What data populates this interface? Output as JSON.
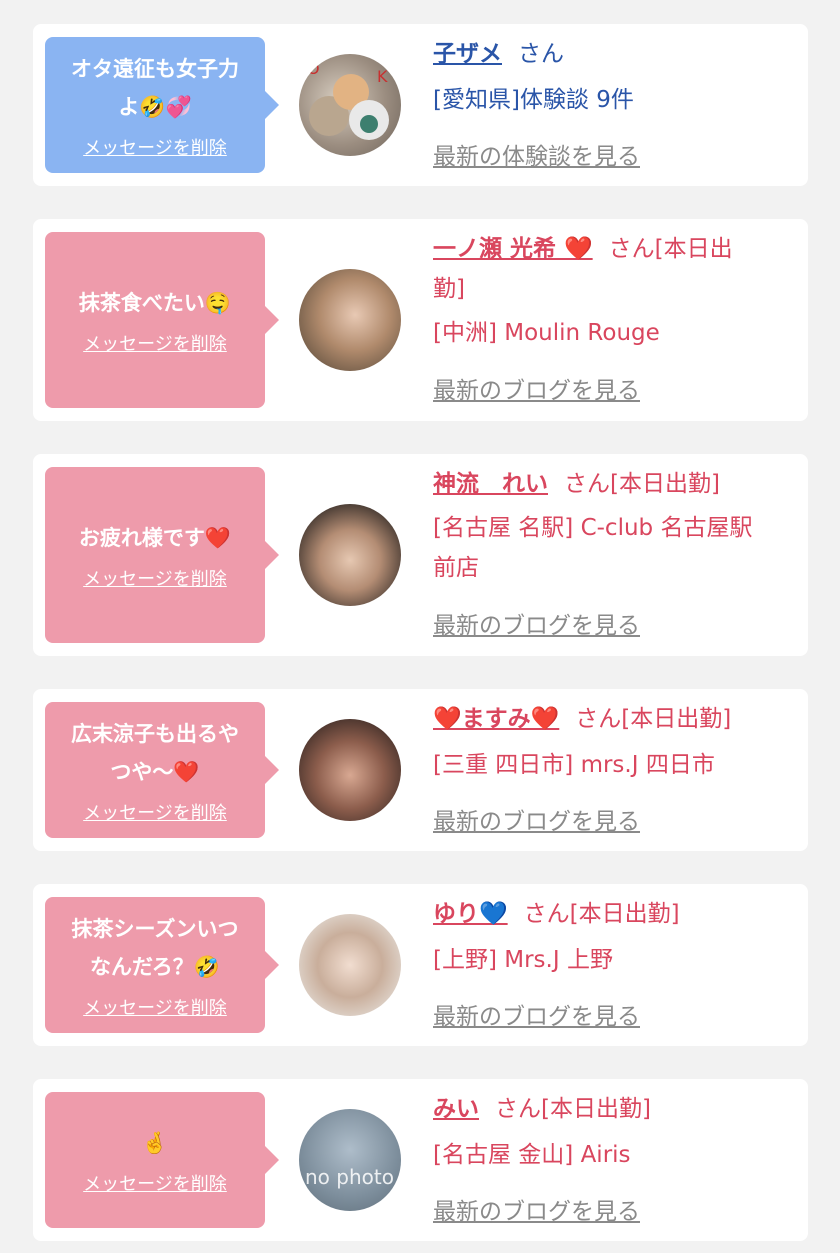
{
  "cards": [
    {
      "bubble_color": "blue",
      "message": "オタ遠征も女子力よ🤣💞",
      "message_lines": [
        "オタ遠征も女子力",
        "よ🤣💞"
      ],
      "delete_label": "メッセージを削除",
      "name": "子ザメ",
      "san": "さん",
      "status": "",
      "location": "[愛知県]体験談 9件",
      "see_label": "最新の体験談を見る"
    },
    {
      "bubble_color": "pink",
      "message": "抹茶食べたい🤤",
      "message_lines": [
        "抹茶食べたい🤤"
      ],
      "delete_label": "メッセージを削除",
      "name": "一ノ瀬 光希 ❤️",
      "san": "さん[本日出",
      "status": "勤]",
      "location": "[中洲] Moulin Rouge",
      "see_label": "最新のブログを見る"
    },
    {
      "bubble_color": "pink",
      "message": "お疲れ様です❤️",
      "message_lines": [
        "お疲れ様です❤️"
      ],
      "delete_label": "メッセージを削除",
      "name": "神流　れい",
      "san": "さん[本日出勤]",
      "status": "",
      "location": "[名古屋 名駅] C-club 名古屋駅前店",
      "location_lines": [
        "[名古屋 名駅] C-club 名古屋駅",
        "前店"
      ],
      "see_label": "最新のブログを見る"
    },
    {
      "bubble_color": "pink",
      "message": "広末涼子も出るやつや〜❤️",
      "message_lines": [
        "広末涼子も出るや",
        "つや〜❤️"
      ],
      "delete_label": "メッセージを削除",
      "name": "❤️ますみ❤️",
      "san": "さん[本日出勤]",
      "status": "",
      "location": "[三重 四日市] mrs.J 四日市",
      "see_label": "最新のブログを見る"
    },
    {
      "bubble_color": "pink",
      "message": "抹茶シーズンいつなんだろ？🤣",
      "message_lines": [
        "抹茶シーズンいつ",
        "なんだろ？🤣"
      ],
      "delete_label": "メッセージを削除",
      "name": "ゆり💙",
      "san": "さん[本日出勤]",
      "status": "",
      "location": "[上野] Mrs.J 上野",
      "see_label": "最新のブログを見る"
    },
    {
      "bubble_color": "pink",
      "message": "🤞",
      "message_lines": [
        "🤞"
      ],
      "delete_label": "メッセージを削除",
      "name": "みい",
      "san": "さん[本日出勤]",
      "status": "",
      "location": "[名古屋 金山] Airis",
      "see_label": "最新のブログを見る",
      "avatar_text": "no photo"
    }
  ],
  "colors": {
    "blue_bubble": "#8ab4f2",
    "pink_bubble": "#ee9bab",
    "blue_text": "#2a55a8",
    "pink_text": "#d9465e",
    "link_gray": "#8a8a8a"
  }
}
